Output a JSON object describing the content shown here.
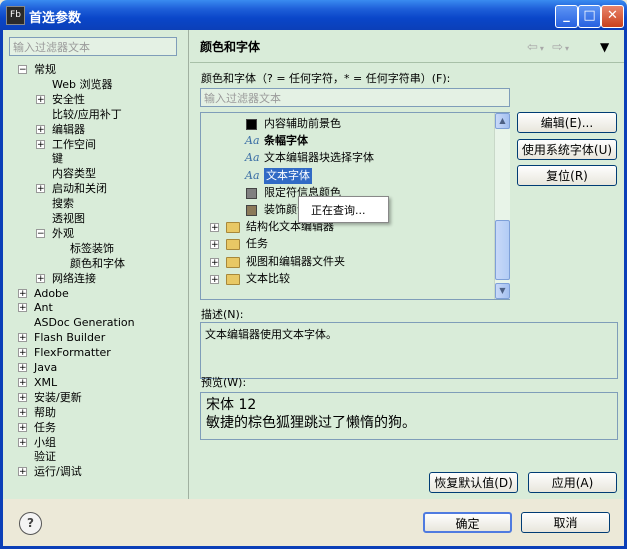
{
  "window": {
    "title": "首选参数",
    "app_icon": "Fb",
    "controls": {
      "minimize": "_",
      "maximize": "□",
      "close": "✕"
    }
  },
  "left": {
    "filter_placeholder": "输入过滤器文本",
    "tree": [
      {
        "label": "常规",
        "expander": "−"
      },
      {
        "label": "Web 浏览器",
        "expander": ""
      },
      {
        "label": "安全性",
        "expander": "+"
      },
      {
        "label": "比较/应用补丁",
        "expander": ""
      },
      {
        "label": "编辑器",
        "expander": "+"
      },
      {
        "label": "工作空间",
        "expander": "+"
      },
      {
        "label": "键",
        "expander": ""
      },
      {
        "label": "内容类型",
        "expander": ""
      },
      {
        "label": "启动和关闭",
        "expander": "+"
      },
      {
        "label": "搜索",
        "expander": ""
      },
      {
        "label": "透视图",
        "expander": ""
      },
      {
        "label": "外观",
        "expander": "−"
      },
      {
        "label": "标签装饰",
        "expander": ""
      },
      {
        "label": "颜色和字体",
        "expander": ""
      },
      {
        "label": "网络连接",
        "expander": "+"
      },
      {
        "label": "Adobe",
        "expander": "+"
      },
      {
        "label": "Ant",
        "expander": "+"
      },
      {
        "label": "ASDoc Generation",
        "expander": ""
      },
      {
        "label": "Flash Builder",
        "expander": "+"
      },
      {
        "label": "FlexFormatter",
        "expander": "+"
      },
      {
        "label": "Java",
        "expander": "+"
      },
      {
        "label": "XML",
        "expander": "+"
      },
      {
        "label": "安装/更新",
        "expander": "+"
      },
      {
        "label": "帮助",
        "expander": "+"
      },
      {
        "label": "任务",
        "expander": "+"
      },
      {
        "label": "小组",
        "expander": "+"
      },
      {
        "label": "验证",
        "expander": ""
      },
      {
        "label": "运行/调试",
        "expander": "+"
      }
    ]
  },
  "right": {
    "title": "颜色和字体",
    "nav": {
      "back": "⇦",
      "forward": "⇨",
      "menu": "▼"
    },
    "section_label": "颜色和字体（? = 任何字符，* = 任何字符串）(F):",
    "filter_placeholder": "输入过滤器文本",
    "items": [
      {
        "label": "内容辅助前景色",
        "kind": "swatch",
        "color": "#000000",
        "expander": ""
      },
      {
        "label": "条幅字体",
        "kind": "font",
        "bold": true,
        "expander": ""
      },
      {
        "label": "文本编辑器块选择字体",
        "kind": "font",
        "expander": ""
      },
      {
        "label": "文本字体",
        "kind": "font",
        "selected": true,
        "expander": ""
      },
      {
        "label": "限定符信息颜色",
        "kind": "swatch",
        "color": "#808080",
        "expander": ""
      },
      {
        "label": "装饰颜色",
        "kind": "swatch",
        "color": "#8c7a5a",
        "expander": ""
      },
      {
        "label": "结构化文本编辑器",
        "kind": "folder",
        "expander": "+"
      },
      {
        "label": "任务",
        "kind": "folder",
        "expander": "+"
      },
      {
        "label": "视图和编辑器文件夹",
        "kind": "folder",
        "expander": "+"
      },
      {
        "label": "文本比较",
        "kind": "folder",
        "expander": "+"
      }
    ],
    "buttons": {
      "edit": "编辑(E)...",
      "use_system_font": "使用系统字体(U)",
      "reset": "复位(R)"
    },
    "popup": "正在查询...",
    "description_label": "描述(N):",
    "description": "文本编辑器使用文本字体。",
    "preview_label": "预览(W):",
    "preview_lines": [
      "宋体 12",
      "敏捷的棕色狐狸跳过了懒惰的狗。"
    ],
    "restore_defaults": "恢复默认值(D)",
    "apply": "应用(A)"
  },
  "bottom": {
    "help": "?",
    "ok": "确定",
    "cancel": "取消"
  }
}
